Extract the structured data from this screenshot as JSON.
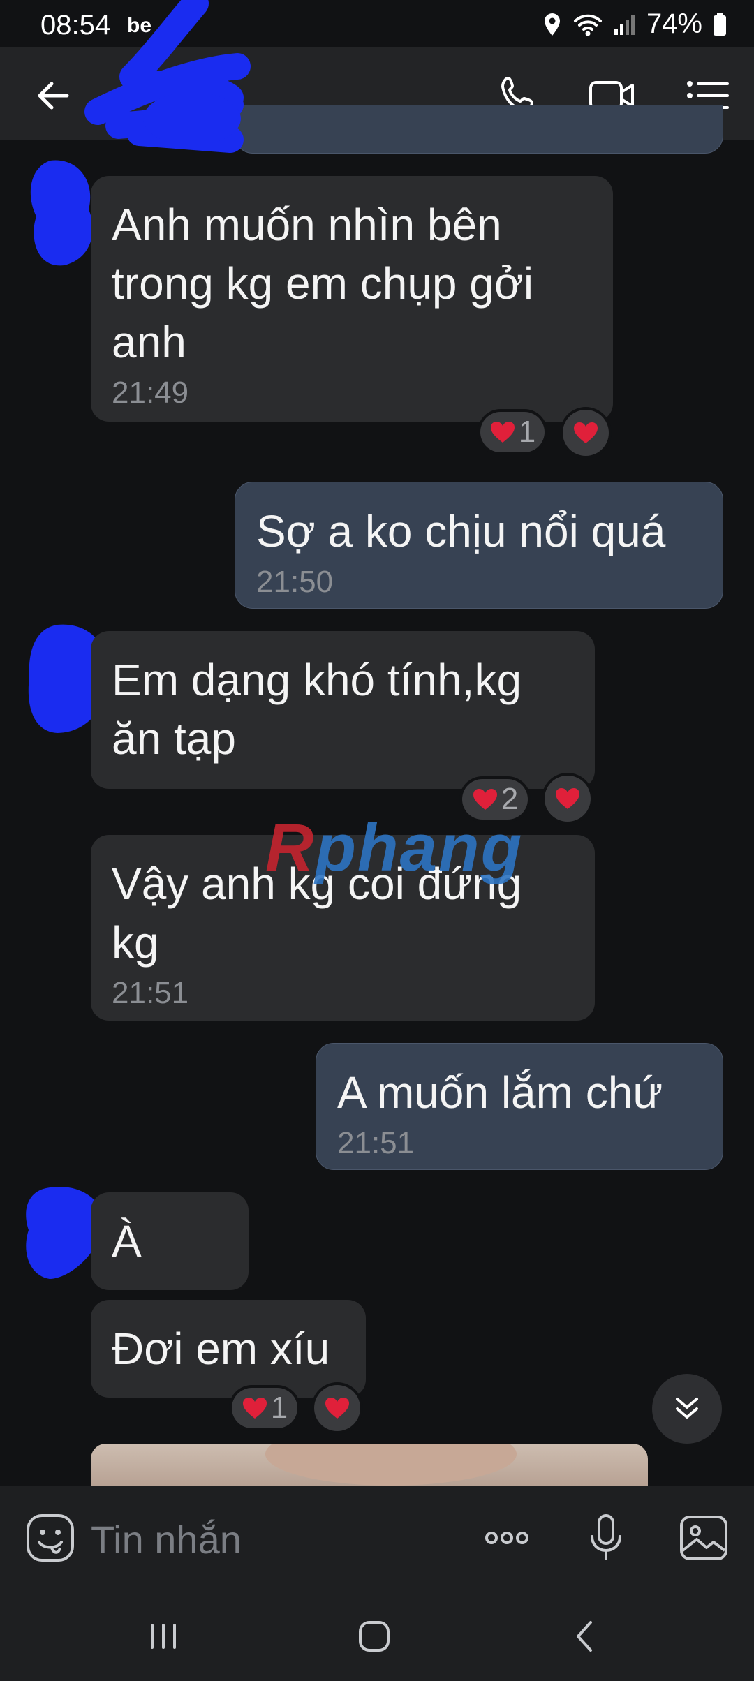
{
  "status_bar": {
    "time": "08:54",
    "carrier": "be",
    "battery": "74%"
  },
  "header": {
    "contact_name": ""
  },
  "messages": [
    {
      "text": "Anh muốn nhìn bên trong kg em chụp gởi anh",
      "time": "21:49",
      "reaction_count": "1"
    },
    {
      "text": "Sợ a ko chịu nổi quá",
      "time": "21:50"
    },
    {
      "text": "Em dạng khó tính,kg ăn tạp",
      "reaction_count": "2"
    },
    {
      "text": "Vậy anh kg coi đứng kg",
      "time": "21:51"
    },
    {
      "text": "A muốn lắm chứ",
      "time": "21:51"
    },
    {
      "text": "À"
    },
    {
      "text": "Đơi em xíu",
      "reaction_count": "1"
    }
  ],
  "watermark": {
    "part1": "R",
    "part2": "phang"
  },
  "composer": {
    "placeholder": "Tin nhắn"
  },
  "colors": {
    "incoming_bubble": "#2b2c2e",
    "outgoing_bubble": "#374253",
    "heart": "#e0203a",
    "scribble": "#1a2cf0"
  },
  "icons": [
    "back-arrow-icon",
    "phone-icon",
    "video-icon",
    "menu-list-icon",
    "sticker-icon",
    "more-icon",
    "microphone-icon",
    "gallery-icon",
    "scroll-down-icon",
    "heart-icon"
  ]
}
